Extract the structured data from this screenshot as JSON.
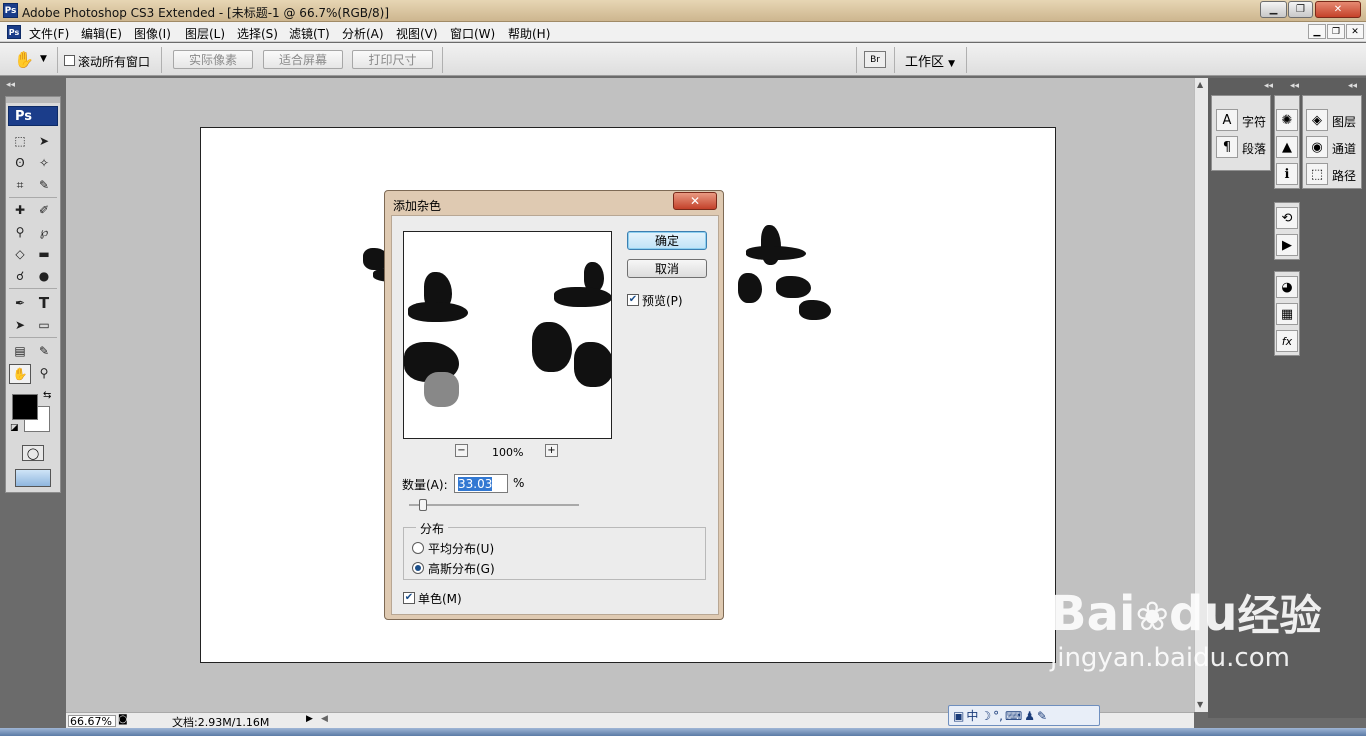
{
  "titlebar": {
    "title": "Adobe Photoshop CS3 Extended - [未标题-1 @ 66.7%(RGB/8)]",
    "app_icon": "Ps"
  },
  "menu": [
    "文件(F)",
    "编辑(E)",
    "图像(I)",
    "图层(L)",
    "选择(S)",
    "滤镜(T)",
    "分析(A)",
    "视图(V)",
    "窗口(W)",
    "帮助(H)"
  ],
  "options": {
    "scroll_all_label": "滚动所有窗口",
    "actual_pixels": "实际像素",
    "fit_screen": "适合屏幕",
    "print_size": "打印尺寸",
    "workspace": "工作区"
  },
  "toolbox": {
    "logo": "Ps"
  },
  "panels": {
    "character": "字符",
    "paragraph": "段落",
    "layers": "图层",
    "channels": "通道",
    "paths": "路径"
  },
  "status": {
    "zoom": "66.67%",
    "doc": "文档:2.93M/1.16M"
  },
  "dialog": {
    "title": "添加杂色",
    "ok": "确定",
    "cancel": "取消",
    "preview_label": "预览(P)",
    "preview_checked": true,
    "preview_zoom": "100%",
    "amount_label": "数量(A):",
    "amount_value": "33.03",
    "amount_unit": "%",
    "distribution_label": "分布",
    "uniform_label": "平均分布(U)",
    "gaussian_label": "高斯分布(G)",
    "selected_distribution": "gaussian",
    "mono_label": "单色(M)",
    "mono_checked": true
  },
  "watermark": {
    "brand": "Bai",
    "brand2": "du",
    "suffix": "经验",
    "url": "jingyan.baidu.com"
  },
  "ime": {
    "mode": "中"
  },
  "colors": {
    "foreground": "#000000",
    "background": "#ffffff"
  }
}
